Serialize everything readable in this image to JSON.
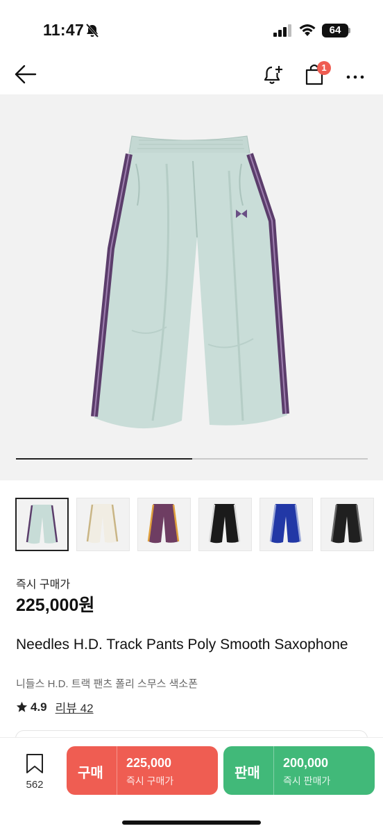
{
  "status_bar": {
    "time": "11:47",
    "battery": "64"
  },
  "nav": {
    "cart_badge": "1"
  },
  "hero": {
    "slide_progress": 0.5
  },
  "thumbnails": [
    {
      "label": "mint",
      "color": "#c7dcd7",
      "stripe": "#5b3d6b",
      "selected": true
    },
    {
      "label": "ivory",
      "color": "#f1ede3",
      "stripe": "#c9b585",
      "selected": false
    },
    {
      "label": "purple",
      "color": "#6e3d62",
      "stripe": "#e0a03c",
      "selected": false
    },
    {
      "label": "black",
      "color": "#1a1a1a",
      "stripe": "#d8d8d8",
      "selected": false
    },
    {
      "label": "royal-blue",
      "color": "#2238a6",
      "stripe": "#9aa7d8",
      "selected": false
    },
    {
      "label": "black-2",
      "color": "#202020",
      "stripe": "#6a6a6a",
      "selected": false
    }
  ],
  "product": {
    "price_label": "즉시 구매가",
    "price": "225,000원",
    "title": "Needles H.D. Track Pants Poly Smooth Saxophone",
    "subtitle": "니들스 H.D. 트랙 팬츠 폴리 스무스 색소폰",
    "rating": "4.9",
    "reviews": "리뷰 42"
  },
  "bottom_bar": {
    "wish_count": "562",
    "buy": {
      "label": "구매",
      "price": "225,000",
      "sub": "즉시 구매가"
    },
    "sell": {
      "label": "판매",
      "price": "200,000",
      "sub": "즉시 판매가"
    }
  },
  "colors": {
    "buy": "#ef5d52",
    "sell": "#41b979",
    "badge": "#ef5d52"
  }
}
